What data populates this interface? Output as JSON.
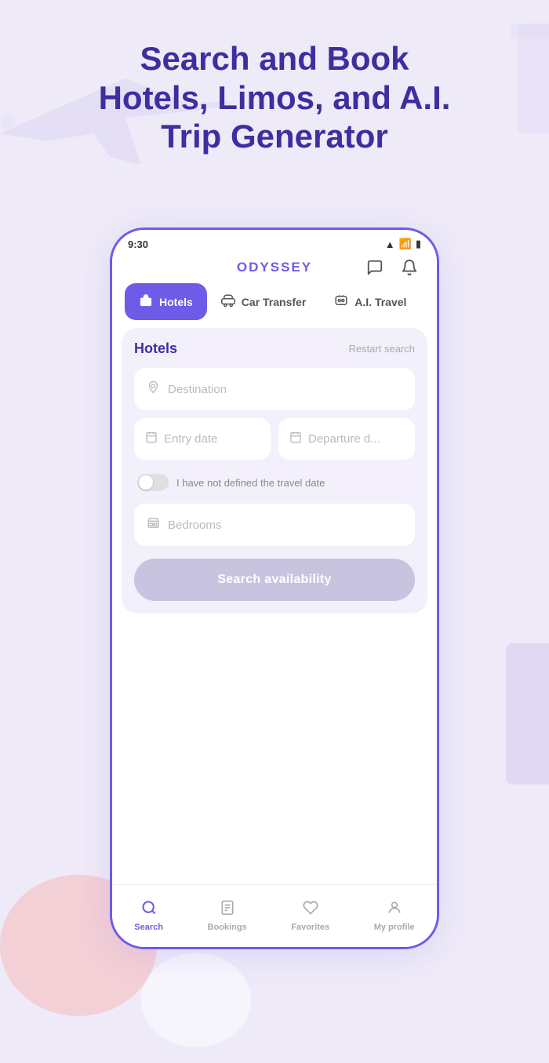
{
  "headline": {
    "line1": "Search and Book",
    "line2": "Hotels, Limos, and A.I.",
    "line3": "Trip Generator"
  },
  "status_bar": {
    "time": "9:30",
    "signal": "▲",
    "wifi": "WiFi",
    "battery": "🔋"
  },
  "app": {
    "title": "ODYSSEY",
    "chat_icon": "💬",
    "bell_icon": "🔔"
  },
  "tabs": [
    {
      "id": "hotels",
      "label": "Hotels",
      "icon": "🏨",
      "active": true
    },
    {
      "id": "car-transfer",
      "label": "Car Transfer",
      "icon": "🚗",
      "active": false
    },
    {
      "id": "ai-travel",
      "label": "A.I. Travel",
      "icon": "🤖",
      "active": false
    }
  ],
  "hotels_section": {
    "title": "Hotels",
    "restart_label": "Restart search",
    "destination_placeholder": "Destination",
    "entry_date_placeholder": "Entry date",
    "departure_date_placeholder": "Departure d...",
    "toggle_label": "I have not defined the travel date",
    "bedrooms_placeholder": "Bedrooms",
    "search_button_label": "Search availability"
  },
  "bottom_nav": [
    {
      "id": "search",
      "label": "Search",
      "icon": "🔍",
      "active": true
    },
    {
      "id": "bookings",
      "label": "Bookings",
      "icon": "📋",
      "active": false
    },
    {
      "id": "favorites",
      "label": "Favorites",
      "icon": "❤️",
      "active": false
    },
    {
      "id": "profile",
      "label": "My profile",
      "icon": "👤",
      "active": false
    }
  ],
  "colors": {
    "primary": "#6c5ce7",
    "headline": "#3d2fa0",
    "bg": "#eeeaf8"
  }
}
